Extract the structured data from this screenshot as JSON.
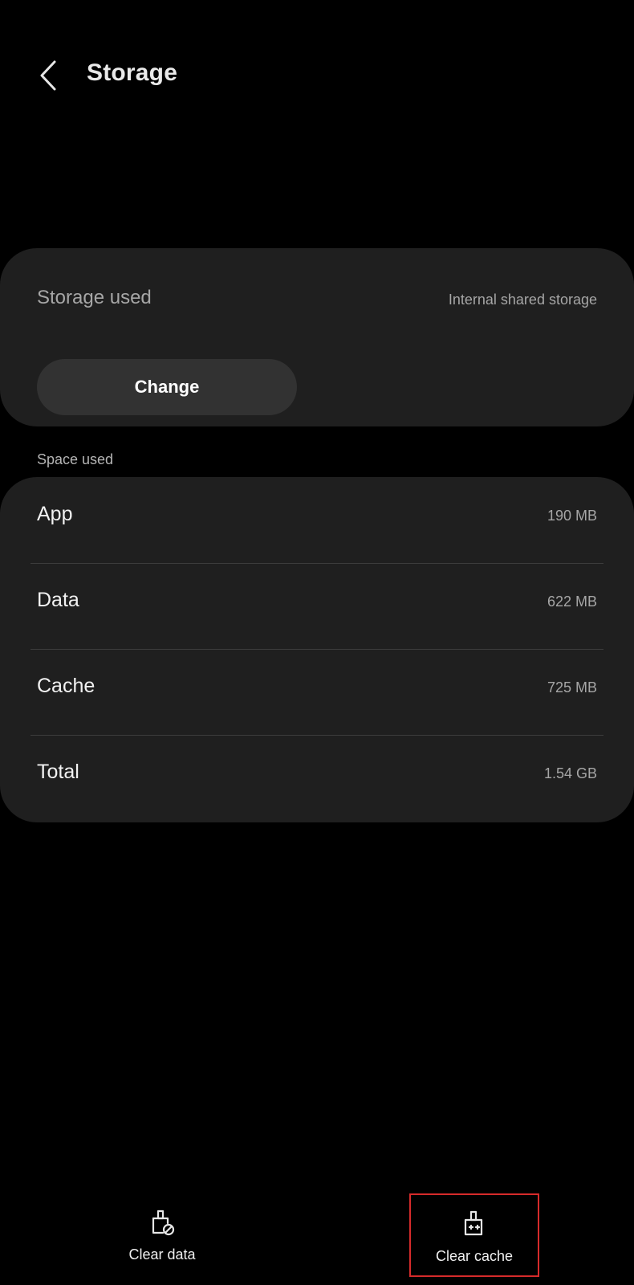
{
  "header": {
    "title": "Storage",
    "back_icon": "chevron-left-icon"
  },
  "storage_card": {
    "label": "Storage used",
    "location": "Internal shared storage",
    "change_label": "Change"
  },
  "space_used": {
    "section_label": "Space used",
    "rows": [
      {
        "label": "App",
        "value": "190 MB"
      },
      {
        "label": "Data",
        "value": "622 MB"
      },
      {
        "label": "Cache",
        "value": "725 MB"
      },
      {
        "label": "Total",
        "value": "1.54 GB"
      }
    ]
  },
  "bottom_actions": {
    "clear_data_label": "Clear data",
    "clear_data_icon": "clear-data-icon",
    "clear_cache_label": "Clear cache",
    "clear_cache_icon": "clear-cache-icon"
  },
  "colors": {
    "background": "#000000",
    "card": "#1f1f1f",
    "button": "#323232",
    "highlight": "#d62b2b"
  }
}
